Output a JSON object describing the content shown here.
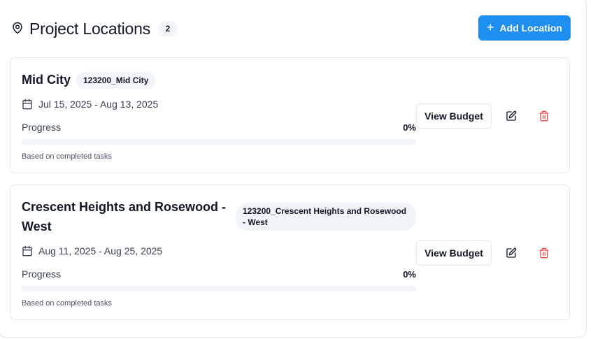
{
  "header": {
    "title": "Project Locations",
    "count": "2",
    "add_button_label": "Add Location"
  },
  "locations": [
    {
      "name": "Mid City",
      "code": "123200_Mid City",
      "dates": "Jul 15, 2025 - Aug 13, 2025",
      "progress_label": "Progress",
      "progress_value": "0%",
      "progress_fraction": 0,
      "progress_note": "Based on completed tasks",
      "view_budget_label": "View Budget"
    },
    {
      "name": "Crescent Heights and Rosewood - West",
      "code": "123200_Crescent Heights and Rosewood - West",
      "dates": "Aug 11, 2025 - Aug 25, 2025",
      "progress_label": "Progress",
      "progress_value": "0%",
      "progress_fraction": 0,
      "progress_note": "Based on completed tasks",
      "view_budget_label": "View Budget"
    }
  ],
  "icons": {
    "header": "map-pin-icon",
    "add": "plus-icon",
    "date": "calendar-icon",
    "edit": "edit-icon",
    "delete": "trash-icon"
  },
  "colors": {
    "accent": "#1e8ff0",
    "danger": "#ef4444",
    "badge_bg": "#f1f5f9"
  }
}
